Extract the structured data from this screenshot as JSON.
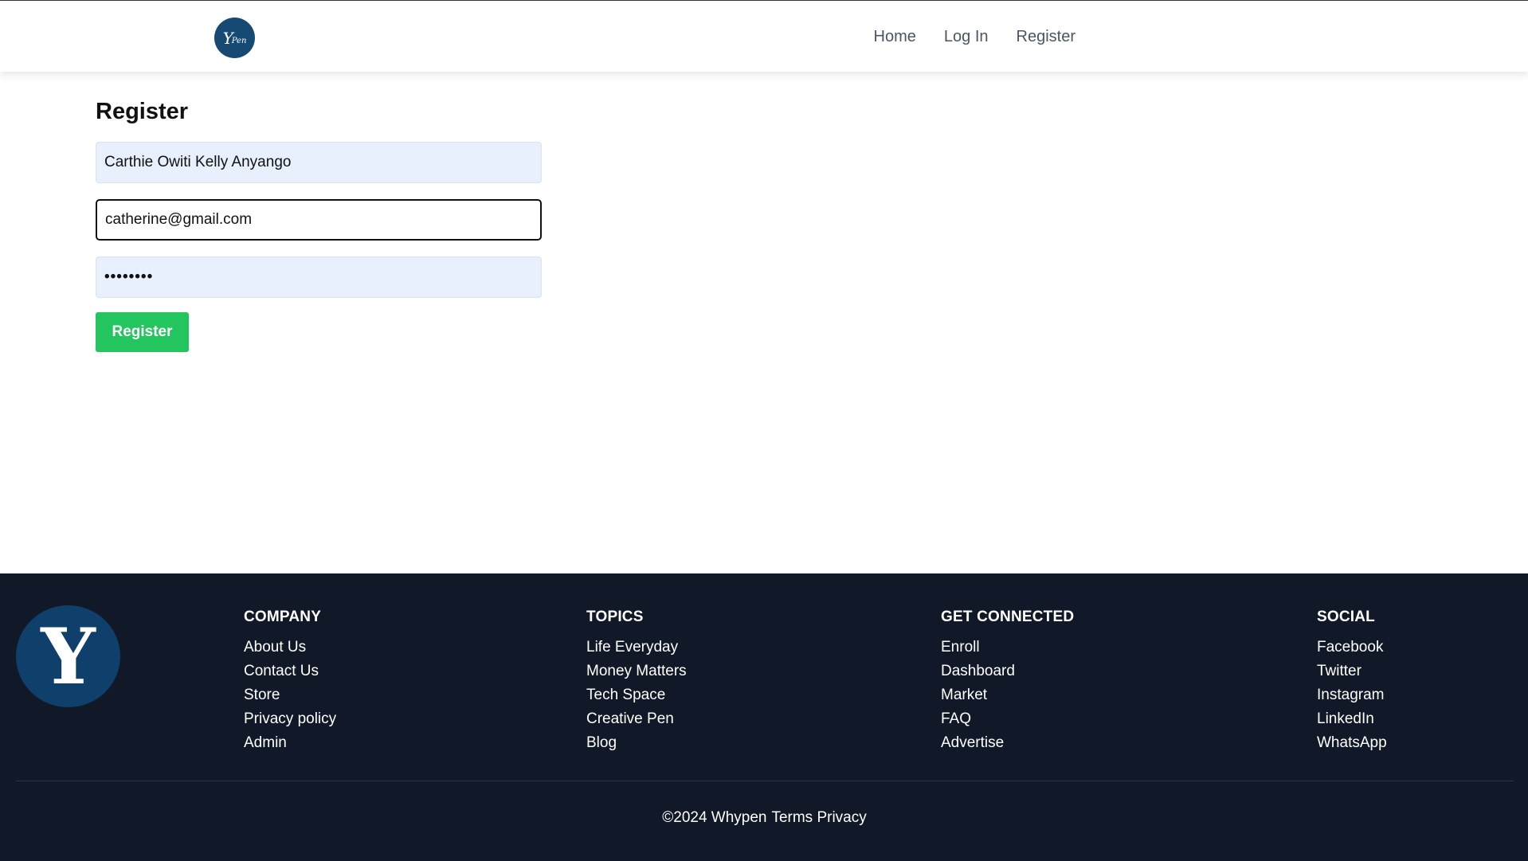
{
  "header": {
    "logo_text": "Y",
    "logo_subtext": "Pen",
    "nav": [
      {
        "label": "Home"
      },
      {
        "label": "Log In"
      },
      {
        "label": "Register"
      }
    ]
  },
  "form": {
    "title": "Register",
    "name_value": "Carthie Owiti Kelly Anyango",
    "email_value": "catherine@gmail.com",
    "password_value": "••••••••",
    "submit_label": "Register"
  },
  "footer": {
    "logo_text": "Y",
    "columns": [
      {
        "heading": "COMPANY",
        "links": [
          "About Us",
          "Contact Us",
          "Store",
          "Privacy policy",
          "Admin"
        ]
      },
      {
        "heading": "TOPICS",
        "links": [
          "Life Everyday",
          "Money Matters",
          "Tech Space",
          "Creative Pen",
          "Blog"
        ]
      },
      {
        "heading": "GET CONNECTED",
        "links": [
          "Enroll",
          "Dashboard",
          "Market",
          "FAQ",
          "Advertise"
        ]
      },
      {
        "heading": "SOCIAL",
        "links": [
          "Facebook",
          "Twitter",
          "Instagram",
          "LinkedIn",
          "WhatsApp"
        ]
      }
    ],
    "copyright": "©2024 Whypen",
    "terms_label": "Terms",
    "privacy_label": "Privacy"
  },
  "colors": {
    "footer_bg": "#111827",
    "button_green": "#22c55e",
    "logo_blue": "#164a73",
    "autofill_bg": "#e8f0fe"
  }
}
